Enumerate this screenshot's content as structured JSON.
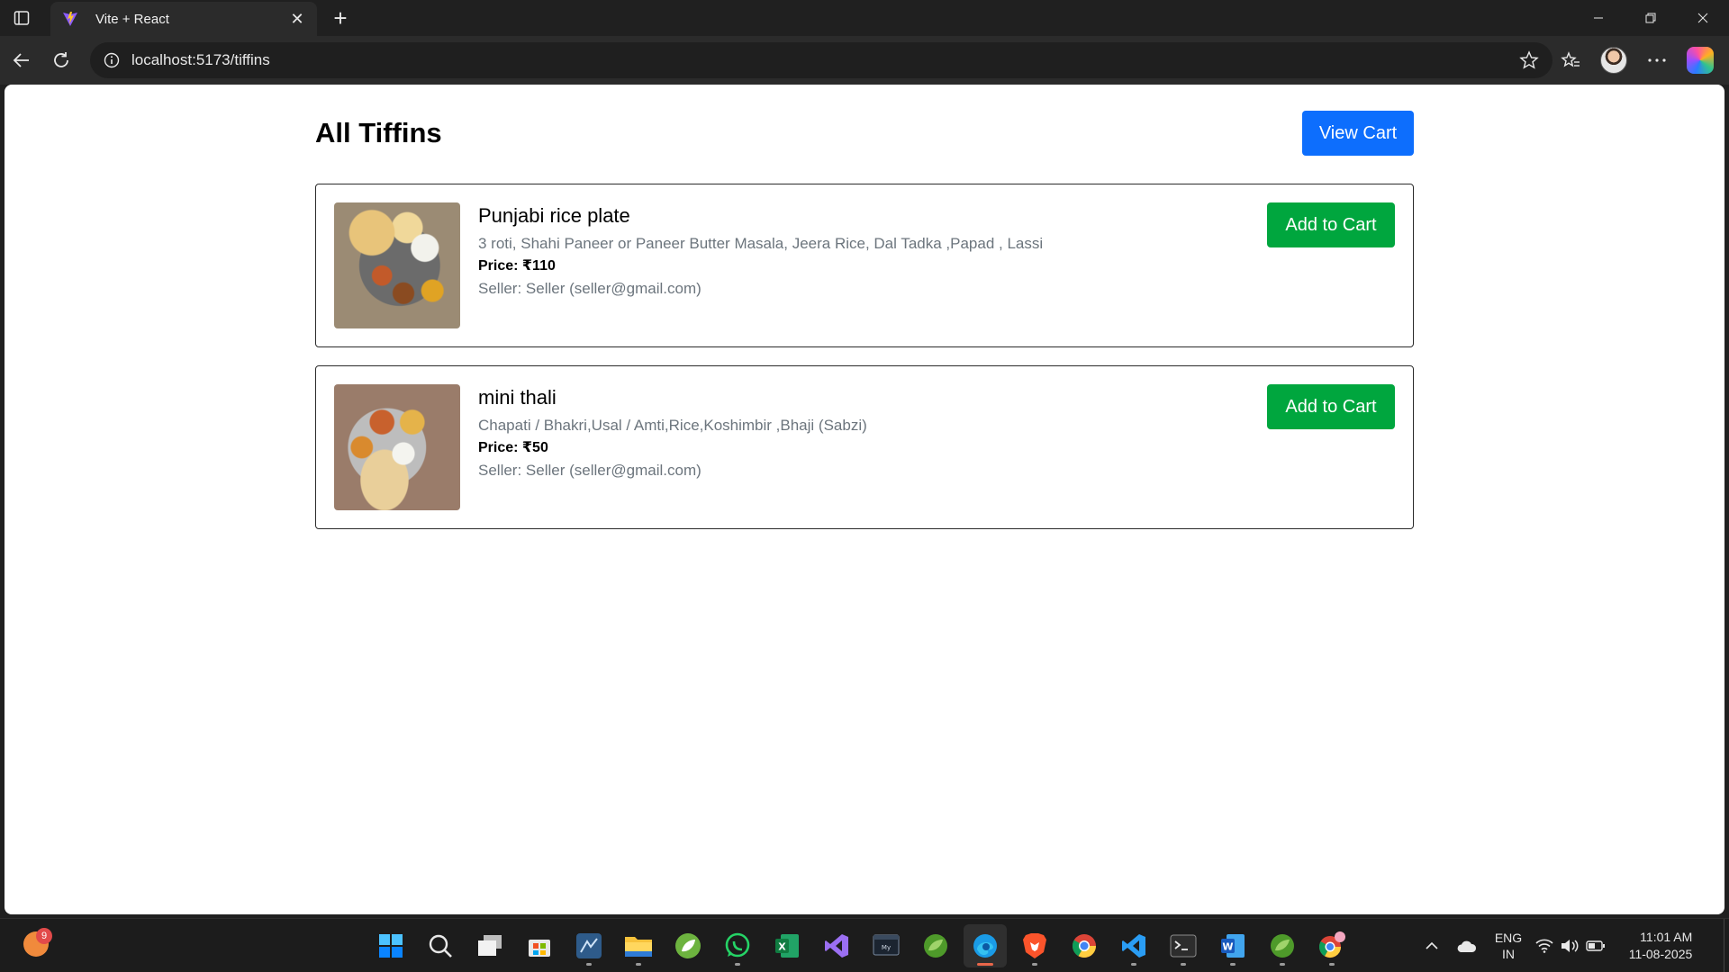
{
  "browser": {
    "tab_title": "Vite + React",
    "url": "localhost:5173/tiffins"
  },
  "page": {
    "title": "All Tiffins",
    "view_cart_label": "View Cart"
  },
  "tiffins": [
    {
      "name": "Punjabi rice plate",
      "description": "3 roti, Shahi Paneer or Paneer Butter Masala, Jeera Rice, Dal Tadka ,Papad , Lassi",
      "price": "Price: ₹110",
      "seller": "Seller: Seller (seller@gmail.com)",
      "add_label": "Add to Cart"
    },
    {
      "name": "mini thali",
      "description": "Chapati / Bhakri,Usal / Amti,Rice,Koshimbir ,Bhaji (Sabzi)",
      "price": "Price: ₹50",
      "seller": "Seller: Seller (seller@gmail.com)",
      "add_label": "Add to Cart"
    }
  ],
  "taskbar": {
    "weather_badge": "9",
    "lang_line1": "ENG",
    "lang_line2": "IN",
    "time": "11:01 AM",
    "date": "11-08-2025",
    "apps": [
      "start",
      "search",
      "task-view",
      "store",
      "app-blue",
      "file-explorer",
      "spring",
      "whatsapp",
      "excel",
      "visual-studio",
      "mysql",
      "spring-tools",
      "edge",
      "brave",
      "chrome",
      "vscode",
      "terminal",
      "word",
      "spring-tools-2",
      "chrome-profile"
    ]
  },
  "colors": {
    "primary": "#0d6efd",
    "success": "#00a63e",
    "muted_text": "#6c757d"
  }
}
